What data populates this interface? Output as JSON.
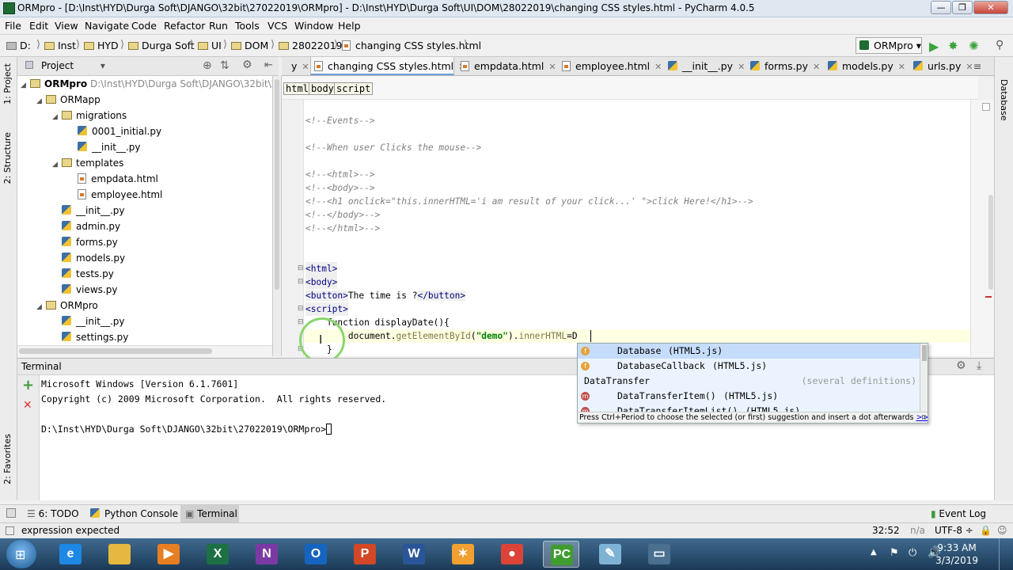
{
  "window": {
    "title": "ORMpro - [D:\\Inst\\HYD\\Durga Soft\\DJANGO\\32bit\\27022019\\ORMpro] - D:\\Inst\\HYD\\Durga Soft\\UI\\DOM\\28022019\\changing CSS styles.html - PyCharm 4.0.5",
    "minimize": "—",
    "maximize": "❐",
    "close": "✕"
  },
  "menu": [
    "File",
    "Edit",
    "View",
    "Navigate",
    "Code",
    "Refactor",
    "Run",
    "Tools",
    "VCS",
    "Window",
    "Help"
  ],
  "nav": {
    "crumbs": [
      "D:",
      "Inst",
      "HYD",
      "Durga Soft",
      "UI",
      "DOM",
      "28022019",
      "changing CSS styles.html"
    ],
    "run_config": "ORMpro"
  },
  "project": {
    "header": "Project",
    "root": "ORMpro",
    "root_path": "D:\\Inst\\HYD\\Durga Soft\\DJANGO\\32bit\\27",
    "tree": [
      {
        "label": "ORMapp",
        "type": "folder",
        "level": 1,
        "open": true
      },
      {
        "label": "migrations",
        "type": "folder",
        "level": 2,
        "open": true
      },
      {
        "label": "0001_initial.py",
        "type": "py",
        "level": 3
      },
      {
        "label": "__init__.py",
        "type": "py",
        "level": 3
      },
      {
        "label": "templates",
        "type": "folder",
        "level": 2,
        "open": true
      },
      {
        "label": "empdata.html",
        "type": "html",
        "level": 3
      },
      {
        "label": "employee.html",
        "type": "html",
        "level": 3
      },
      {
        "label": "__init__.py",
        "type": "py",
        "level": 2
      },
      {
        "label": "admin.py",
        "type": "py",
        "level": 2
      },
      {
        "label": "forms.py",
        "type": "py",
        "level": 2
      },
      {
        "label": "models.py",
        "type": "py",
        "level": 2
      },
      {
        "label": "tests.py",
        "type": "py",
        "level": 2
      },
      {
        "label": "views.py",
        "type": "py",
        "level": 2
      },
      {
        "label": "ORMpro",
        "type": "folder",
        "level": 1,
        "open": true
      },
      {
        "label": "__init__.py",
        "type": "py",
        "level": 2
      },
      {
        "label": "settings.py",
        "type": "py",
        "level": 2
      }
    ]
  },
  "tabs": [
    {
      "label": "y",
      "active": false
    },
    {
      "label": "changing CSS styles.html",
      "active": true
    },
    {
      "label": "empdata.html",
      "active": false
    },
    {
      "label": "employee.html",
      "active": false
    },
    {
      "label": "__init__.py",
      "active": false
    },
    {
      "label": "forms.py",
      "active": false
    },
    {
      "label": "models.py",
      "active": false
    },
    {
      "label": "urls.py",
      "active": false
    }
  ],
  "tab_overflow": "≡",
  "side_tabs": {
    "left": [
      "1: Project",
      "2: Structure",
      "2: Favorites"
    ],
    "right": [
      "Database"
    ]
  },
  "tag_crumbs": [
    "html",
    "body",
    "script"
  ],
  "code": [
    {
      "text": "<!--Events-->",
      "kind": "cmt"
    },
    {
      "text": "",
      "kind": "plain"
    },
    {
      "text": "<!--When user Clicks the mouse-->",
      "kind": "cmt"
    },
    {
      "text": "",
      "kind": "plain"
    },
    {
      "text": "<!--<html>-->",
      "kind": "cmt"
    },
    {
      "text": "<!--<body>-->",
      "kind": "cmt"
    },
    {
      "text": "<!--<h1 onclick=\"this.innerHTML='i am result of your click...' \">click Here!</h1>-->",
      "kind": "cmt"
    },
    {
      "text": "<!--</body>-->",
      "kind": "cmt"
    },
    {
      "text": "<!--</html>-->",
      "kind": "cmt"
    },
    {
      "text": "",
      "kind": "plain"
    },
    {
      "text": "",
      "kind": "plain"
    },
    {
      "text": "<html>",
      "kind": "tag"
    },
    {
      "text": "<body>",
      "kind": "tag"
    },
    {
      "text": "<button>The time is ?</button>",
      "kind": "mixed"
    },
    {
      "text": "<script>",
      "kind": "tag"
    },
    {
      "text": "    function displayDate(){",
      "kind": "plain"
    },
    {
      "text": "        document.getElementById(\"demo\").innerHTML=D",
      "kind": "current"
    },
    {
      "text": "    }",
      "kind": "plain"
    }
  ],
  "autocomplete": {
    "items": [
      {
        "name": "Database",
        "source": "(HTML5.js)",
        "badge": "f",
        "selected": true
      },
      {
        "name": "DatabaseCallback",
        "source": "(HTML5.js)",
        "badge": "f",
        "selected": false
      },
      {
        "name": "DataTransfer",
        "source": "(several definitions)",
        "badge": "",
        "selected": false
      },
      {
        "name": "DataTransferItem()",
        "source": "(HTML5.js)",
        "badge": "m",
        "selected": false
      },
      {
        "name": "DataTransferItemList()",
        "source": "(HTML5.js)",
        "badge": "m",
        "selected": false
      }
    ],
    "hint": "Press Ctrl+Period to choose the selected (or first) suggestion and insert a dot afterwards",
    "hint_link": ">>",
    "pi": "π"
  },
  "terminal": {
    "title": "Terminal",
    "lines": [
      "Microsoft Windows [Version 6.1.7601]",
      "Copyright (c) 2009 Microsoft Corporation.  All rights reserved.",
      "",
      "D:\\Inst\\HYD\\Durga Soft\\DJANGO\\32bit\\27022019\\ORMpro>"
    ],
    "add": "+",
    "close": "✕"
  },
  "bottom_tabs": [
    {
      "label": "6: TODO",
      "active": false
    },
    {
      "label": "Python Console",
      "active": false
    },
    {
      "label": "Terminal",
      "active": true
    }
  ],
  "event_log": "Event Log",
  "status": {
    "message": "expression expected",
    "position": "32:52",
    "na": "n/a",
    "encoding": "UTF-8 ÷"
  },
  "taskbar": {
    "time": "9:33 AM",
    "date": "3/3/2019",
    "apps": [
      {
        "name": "ie-icon",
        "glyph": "e",
        "color": "#1e88e5"
      },
      {
        "name": "explorer-icon",
        "glyph": "",
        "color": "#e6b840"
      },
      {
        "name": "media-player-icon",
        "glyph": "▶",
        "color": "#e67e22"
      },
      {
        "name": "excel-icon",
        "glyph": "X",
        "color": "#1d7044"
      },
      {
        "name": "onenote-icon",
        "glyph": "N",
        "color": "#7b3aa3"
      },
      {
        "name": "outlook-icon",
        "glyph": "O",
        "color": "#1565c0"
      },
      {
        "name": "powerpoint-icon",
        "glyph": "P",
        "color": "#d24726"
      },
      {
        "name": "word-icon",
        "glyph": "W",
        "color": "#2a5699"
      },
      {
        "name": "paint-icon",
        "glyph": "✶",
        "color": "#f0a030"
      },
      {
        "name": "chrome-icon",
        "glyph": "●",
        "color": "#db4437"
      },
      {
        "name": "pycharm-icon",
        "glyph": "PC",
        "color": "#3f9d2f"
      },
      {
        "name": "notepad-icon",
        "glyph": "✎",
        "color": "#7fb3d5"
      },
      {
        "name": "remote-icon",
        "glyph": "▭",
        "color": "#4a6f8f"
      }
    ]
  }
}
